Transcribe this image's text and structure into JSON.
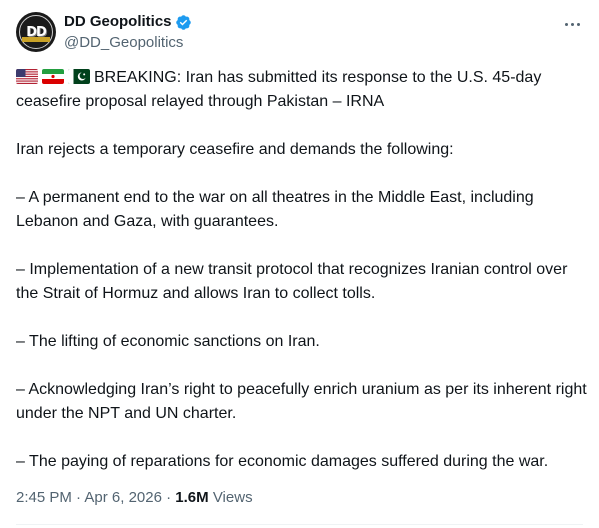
{
  "author": {
    "display_name": "DD Geopolitics",
    "handle": "@DD_Geopolitics",
    "avatar_text": "DD",
    "verified": true,
    "verified_color": "#1d9bf0"
  },
  "menu": {
    "icon": "more-horizontal-icon"
  },
  "flags": [
    "us-flag-icon",
    "iran-flag-icon",
    "pakistan-flag-icon"
  ],
  "tweet": {
    "headline": "BREAKING: Iran has submitted its response to the U.S. 45-day ceasefire proposal relayed through Pakistan – IRNA",
    "intro": "Iran rejects a temporary ceasefire and demands the following:",
    "demands": [
      "– A permanent end to the war on all theatres in the Middle East, including Lebanon and Gaza, with guarantees.",
      "– Implementation of a new transit protocol that recognizes Iranian control over the Strait of Hormuz and allows Iran to collect tolls.",
      "– The lifting of economic sanctions on Iran.",
      "– Acknowledging Iran’s right to peacefully enrich uranium as per its inherent right under the NPT and UN charter.",
      "– The paying of reparations for economic damages suffered during the war."
    ]
  },
  "meta": {
    "time": "2:45 PM",
    "separator": " · ",
    "date": "Apr 6, 2026",
    "views_count": "1.6M",
    "views_label": " Views"
  },
  "colors": {
    "text": "#0f1419",
    "secondary": "#536471"
  }
}
